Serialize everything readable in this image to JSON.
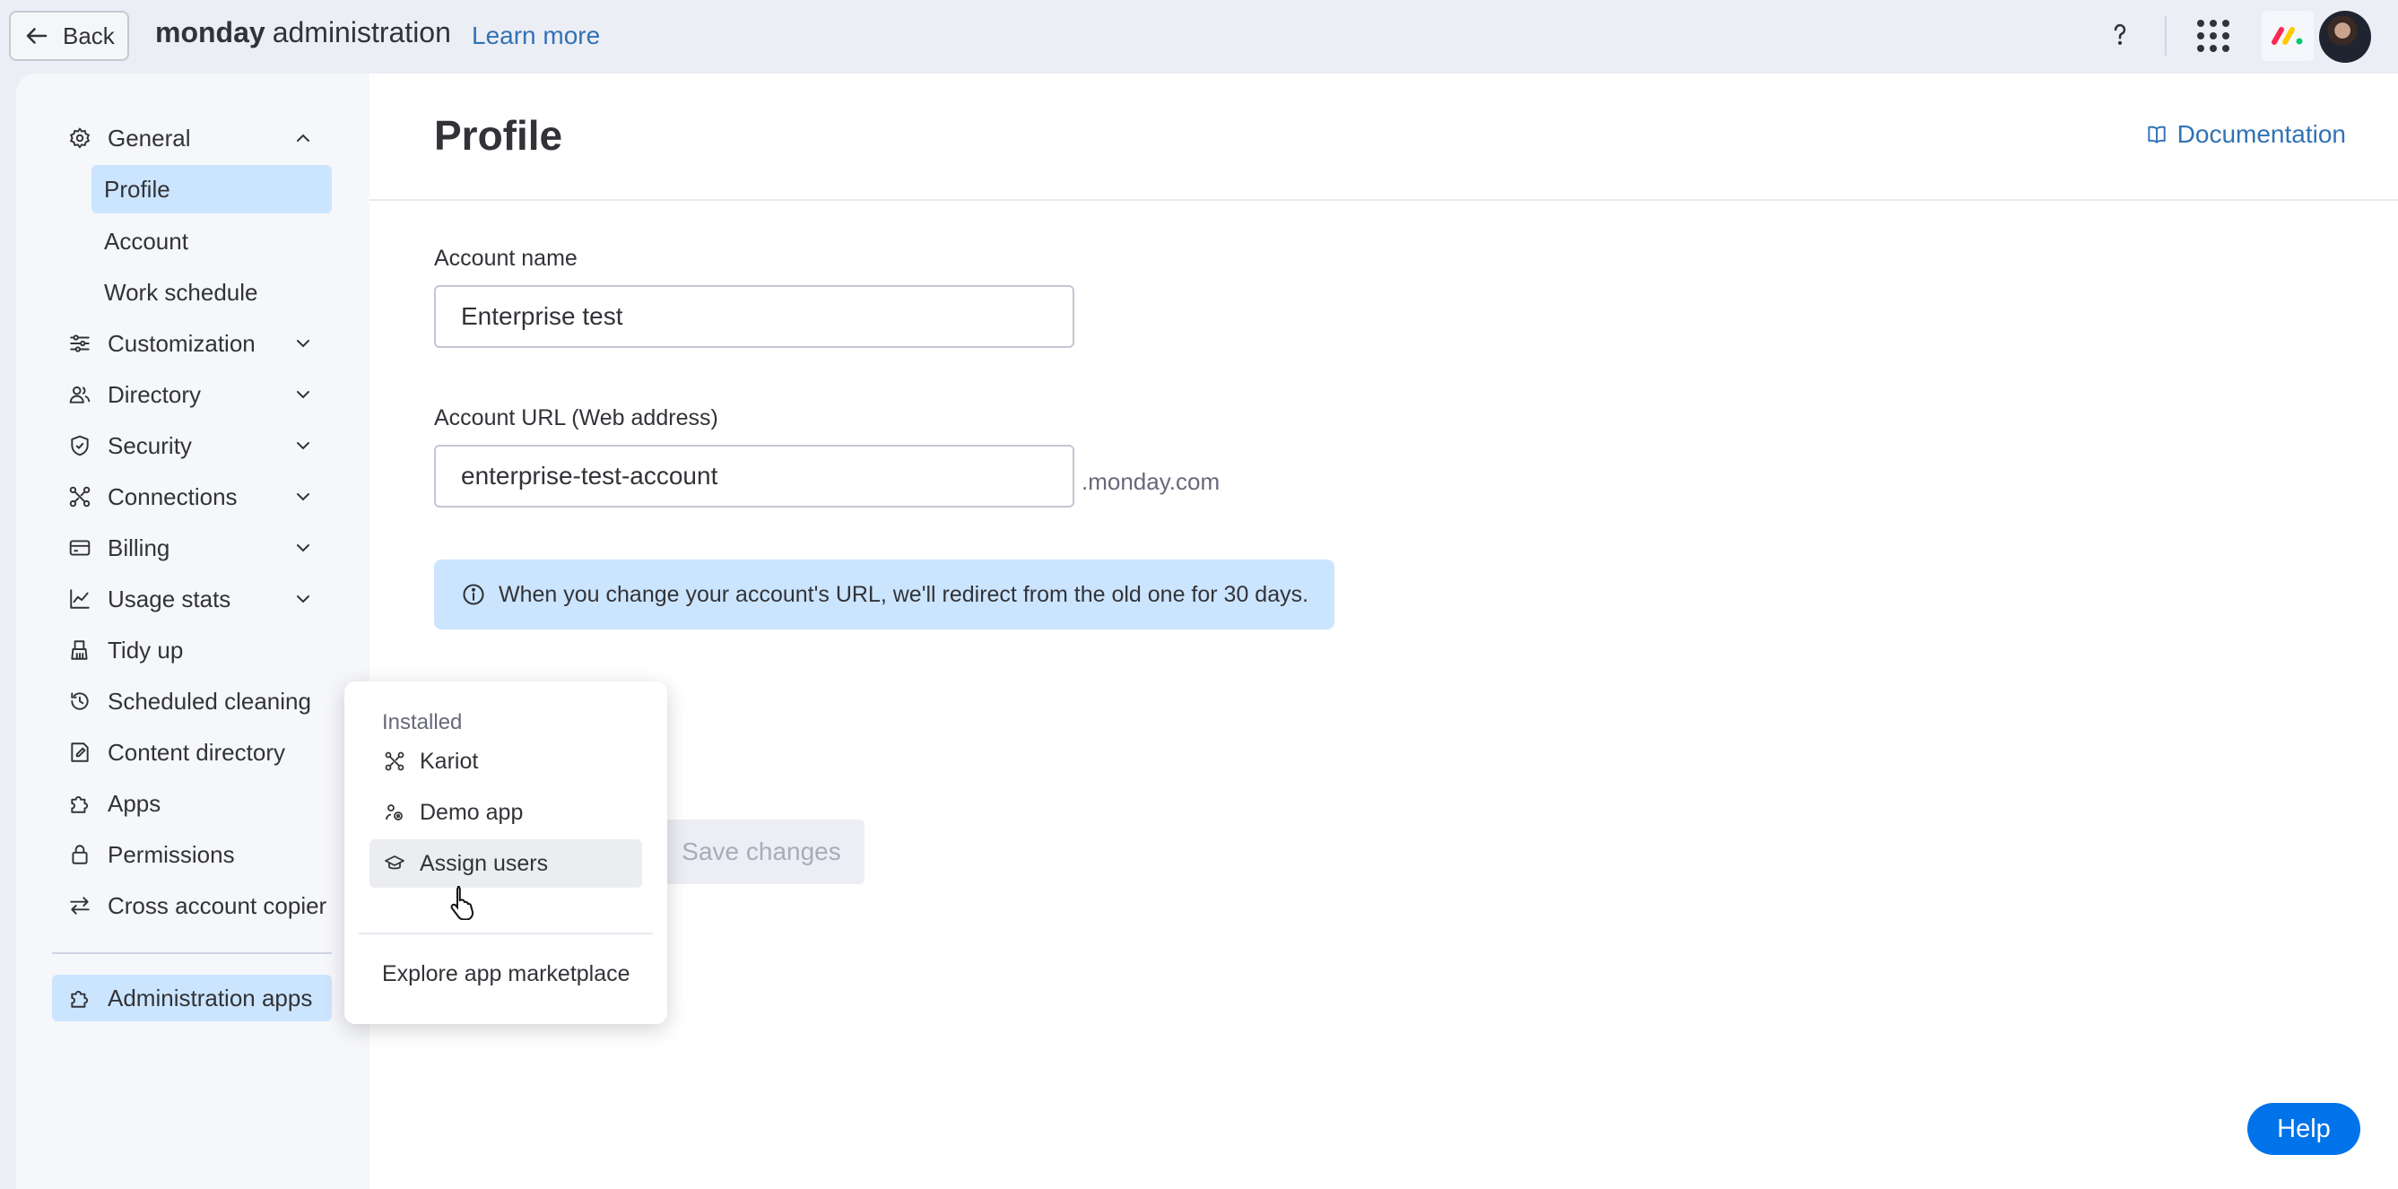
{
  "topbar": {
    "back_label": "Back",
    "brand_bold": "monday",
    "brand_rest": "administration",
    "learn_more": "Learn more",
    "help_icon": "question-icon",
    "apps_icon": "grid-icon"
  },
  "sidebar": {
    "items": [
      {
        "label": "General",
        "icon": "gear-icon",
        "chevron": "up"
      },
      {
        "label": "Customization",
        "icon": "sliders-icon",
        "chevron": "down"
      },
      {
        "label": "Directory",
        "icon": "people-icon",
        "chevron": "down"
      },
      {
        "label": "Security",
        "icon": "shield-icon",
        "chevron": "down"
      },
      {
        "label": "Connections",
        "icon": "connections-icon",
        "chevron": "down"
      },
      {
        "label": "Billing",
        "icon": "card-icon",
        "chevron": "down"
      },
      {
        "label": "Usage stats",
        "icon": "chart-icon",
        "chevron": "down"
      },
      {
        "label": "Tidy up",
        "icon": "broom-icon"
      },
      {
        "label": "Scheduled cleaning",
        "icon": "history-icon"
      },
      {
        "label": "Content directory",
        "icon": "content-icon"
      },
      {
        "label": "Apps",
        "icon": "puzzle-icon"
      },
      {
        "label": "Permissions",
        "icon": "lock-icon"
      },
      {
        "label": "Cross account copier",
        "icon": "arrows-icon"
      }
    ],
    "general_sub": [
      {
        "label": "Profile",
        "active": true
      },
      {
        "label": "Account"
      },
      {
        "label": "Work schedule"
      }
    ],
    "admin_apps": "Administration apps"
  },
  "main": {
    "title": "Profile",
    "documentation": "Documentation",
    "account_name_label": "Account name",
    "account_name_value": "Enterprise test",
    "account_url_label": "Account URL (Web address)",
    "account_url_value": "enterprise-test-account",
    "url_suffix": ".monday.com",
    "info_text": "When you change your account's URL, we'll redirect from the old one for 30 days.",
    "save_label": "Save changes",
    "help_label": "Help"
  },
  "popup": {
    "heading": "Installed",
    "items": [
      {
        "label": "Kariot",
        "icon": "nodes-icon"
      },
      {
        "label": "Demo app",
        "icon": "demo-app-icon"
      },
      {
        "label": "Assign users",
        "icon": "graduation-cap-icon",
        "hovered": true
      }
    ],
    "explore": "Explore app marketplace"
  },
  "colors": {
    "accent_blue": "#0073ea",
    "link_blue": "#3172b5",
    "selected_bg": "#cce5ff",
    "page_bg": "#eceef5"
  }
}
